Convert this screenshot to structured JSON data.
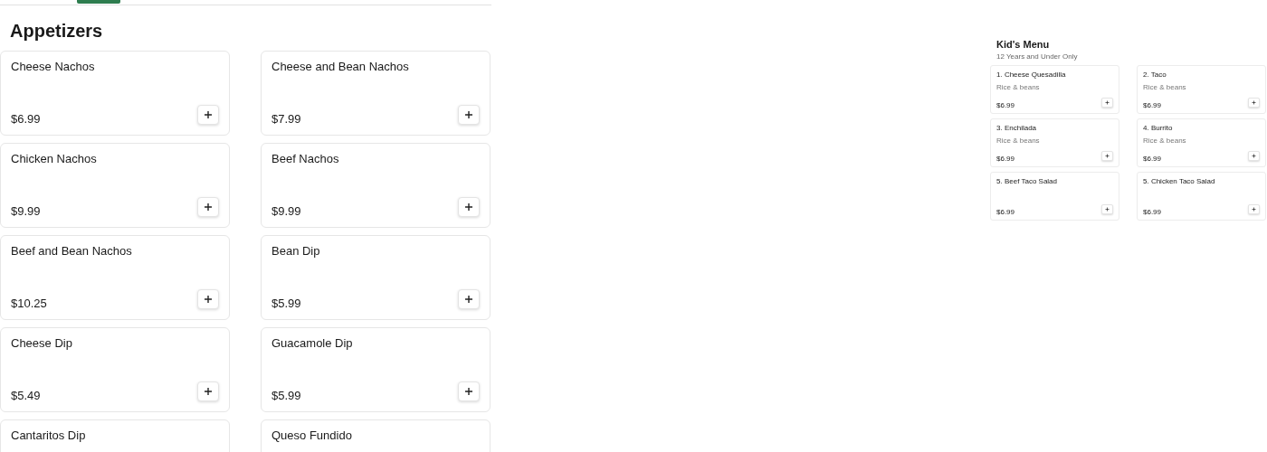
{
  "tabs": [
    {
      "selected": false
    },
    {
      "selected": true
    },
    {
      "selected": false
    }
  ],
  "appetizers": {
    "title": "Appetizers",
    "items": [
      {
        "name": "Cheese Nachos",
        "price": "$6.99"
      },
      {
        "name": "Cheese and Bean Nachos",
        "price": "$7.99"
      },
      {
        "name": "Chicken Nachos",
        "price": "$9.99"
      },
      {
        "name": "Beef Nachos",
        "price": "$9.99"
      },
      {
        "name": "Beef and Bean Nachos",
        "price": "$10.25"
      },
      {
        "name": "Bean Dip",
        "price": "$5.99"
      },
      {
        "name": "Cheese Dip",
        "price": "$5.49"
      },
      {
        "name": "Guacamole Dip",
        "price": "$5.99"
      },
      {
        "name": "Cantaritos Dip"
      },
      {
        "name": "Queso Fundido"
      }
    ]
  },
  "kids_menu": {
    "title": "Kid's Menu",
    "subtitle": "12 Years and Under Only",
    "items": [
      {
        "name": "1. Cheese Quesadilla",
        "description": "Rice & beans",
        "price": "$6.99"
      },
      {
        "name": "2. Taco",
        "description": "Rice & beans",
        "price": "$6.99"
      },
      {
        "name": "3. Enchilada",
        "description": "Rice & beans",
        "price": "$6.99"
      },
      {
        "name": "4. Burrito",
        "description": "Rice & beans",
        "price": "$6.99"
      },
      {
        "name": "5. Beef Taco Salad",
        "price": "$6.99"
      },
      {
        "name": "5. Chicken Taco Salad",
        "price": "$6.99"
      }
    ]
  }
}
